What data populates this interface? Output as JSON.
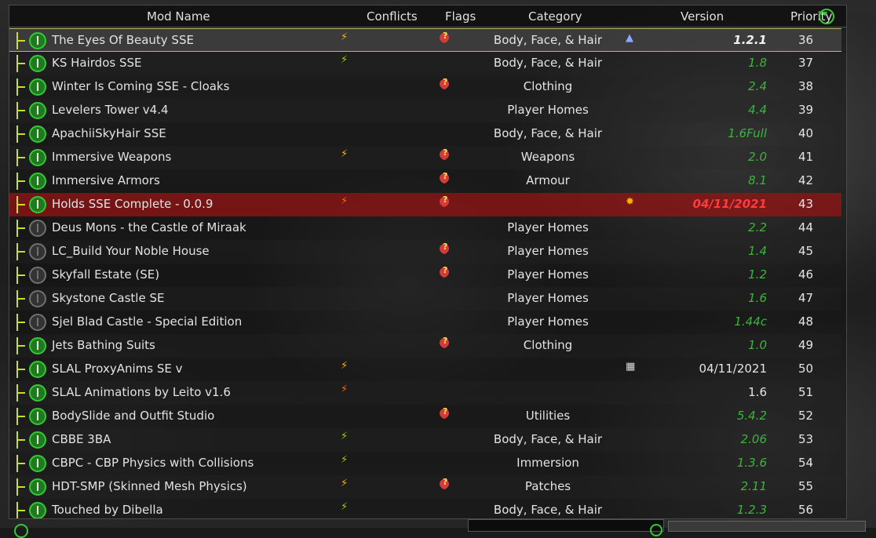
{
  "columns": {
    "mod_name": "Mod Name",
    "conflicts": "Conflicts",
    "flags": "Flags",
    "category": "Category",
    "version": "Version",
    "priority": "Priority"
  },
  "colors": {
    "accent_green": "#36c836",
    "version_green": "#3cb43c",
    "tree_line": "#c8e020",
    "selected_border": "#bdb76b",
    "highlight_red": "#961414"
  },
  "mods": [
    {
      "name": "The Eyes Of Beauty SSE",
      "enabled": true,
      "conflict_icon": "conflict-overwrite-icon",
      "flag": true,
      "category": "Body, Face, & Hair",
      "version_icon": "warning-icon",
      "version": "1.2.1",
      "version_style": "bold",
      "priority": "36",
      "selected": true
    },
    {
      "name": "KS Hairdos SSE",
      "enabled": true,
      "conflict_icon": "conflict-mixed-icon",
      "flag": false,
      "category": "Body, Face, & Hair",
      "version": "1.8",
      "version_style": "green",
      "priority": "37"
    },
    {
      "name": "Winter Is Coming SSE - Cloaks",
      "enabled": true,
      "flag": true,
      "category": "Clothing",
      "version": "2.4",
      "version_style": "green",
      "priority": "38"
    },
    {
      "name": "Levelers Tower v4.4",
      "enabled": true,
      "flag": false,
      "category": "Player Homes",
      "version": "4.4",
      "version_style": "green",
      "priority": "39"
    },
    {
      "name": "ApachiiSkyHair SSE",
      "enabled": true,
      "flag": false,
      "category": "Body, Face, & Hair",
      "version": "1.6Full",
      "version_style": "green",
      "priority": "40"
    },
    {
      "name": "Immersive Weapons",
      "enabled": true,
      "conflict_icon": "conflict-overwrite-icon",
      "flag": true,
      "category": "Weapons",
      "version": "2.0",
      "version_style": "green",
      "priority": "41"
    },
    {
      "name": "Immersive Armors",
      "enabled": true,
      "flag": true,
      "category": "Armour",
      "version": "8.1",
      "version_style": "green",
      "priority": "42"
    },
    {
      "name": "Holds SSE Complete - 0.0.9",
      "enabled": true,
      "conflict_icon": "conflict-overwritten-icon",
      "flag": true,
      "category": "",
      "version_icon": "burst-icon",
      "version": "04/11/2021",
      "version_style": "red",
      "priority": "43",
      "highlight": true
    },
    {
      "name": "Deus Mons - the Castle of Miraak",
      "enabled": false,
      "flag": false,
      "category": "Player Homes",
      "version": "2.2",
      "version_style": "green",
      "priority": "44"
    },
    {
      "name": "LC_Build Your Noble House",
      "enabled": false,
      "flag": true,
      "category": "Player Homes",
      "version": "1.4",
      "version_style": "green",
      "priority": "45"
    },
    {
      "name": "Skyfall Estate (SE)",
      "enabled": false,
      "flag": true,
      "category": "Player Homes",
      "version": "1.2",
      "version_style": "green",
      "priority": "46"
    },
    {
      "name": "Skystone Castle SE",
      "enabled": false,
      "flag": false,
      "category": "Player Homes",
      "version": "1.6",
      "version_style": "green",
      "priority": "47"
    },
    {
      "name": "Sjel Blad Castle - Special Edition",
      "enabled": false,
      "flag": false,
      "category": "Player Homes",
      "version": "1.44c",
      "version_style": "green",
      "priority": "48"
    },
    {
      "name": "Jets Bathing Suits",
      "enabled": true,
      "flag": true,
      "category": "Clothing",
      "version": "1.0",
      "version_style": "green",
      "priority": "49"
    },
    {
      "name": "SLAL ProxyAnims SE v",
      "enabled": true,
      "conflict_icon": "conflict-overwrite-icon",
      "flag": false,
      "category": "",
      "version_icon": "calendar-icon",
      "version": "04/11/2021",
      "version_style": "plain",
      "priority": "50"
    },
    {
      "name": "SLAL Animations by Leito v1.6",
      "enabled": true,
      "conflict_icon": "conflict-overwritten-icon",
      "flag": false,
      "category": "",
      "version": "1.6",
      "version_style": "plain",
      "priority": "51"
    },
    {
      "name": "BodySlide and Outfit Studio",
      "enabled": true,
      "flag": true,
      "category": "Utilities",
      "version": "5.4.2",
      "version_style": "green",
      "priority": "52"
    },
    {
      "name": "CBBE 3BA",
      "enabled": true,
      "conflict_icon": "conflict-mixed-icon",
      "flag": false,
      "category": "Body, Face, & Hair",
      "version": "2.06",
      "version_style": "green",
      "priority": "53"
    },
    {
      "name": "CBPC - CBP Physics with Collisions",
      "enabled": true,
      "conflict_icon": "conflict-mixed-icon",
      "flag": false,
      "category": "Immersion",
      "version": "1.3.6",
      "version_style": "green",
      "priority": "54"
    },
    {
      "name": "HDT-SMP (Skinned Mesh Physics)",
      "enabled": true,
      "conflict_icon": "conflict-overwrite-icon",
      "flag": true,
      "category": "Patches",
      "version": "2.11",
      "version_style": "green",
      "priority": "55"
    },
    {
      "name": "Touched by Dibella",
      "enabled": true,
      "conflict_icon": "conflict-mixed-icon",
      "flag": false,
      "category": "Body, Face, & Hair",
      "version": "1.2.3",
      "version_style": "green",
      "priority": "56"
    }
  ]
}
